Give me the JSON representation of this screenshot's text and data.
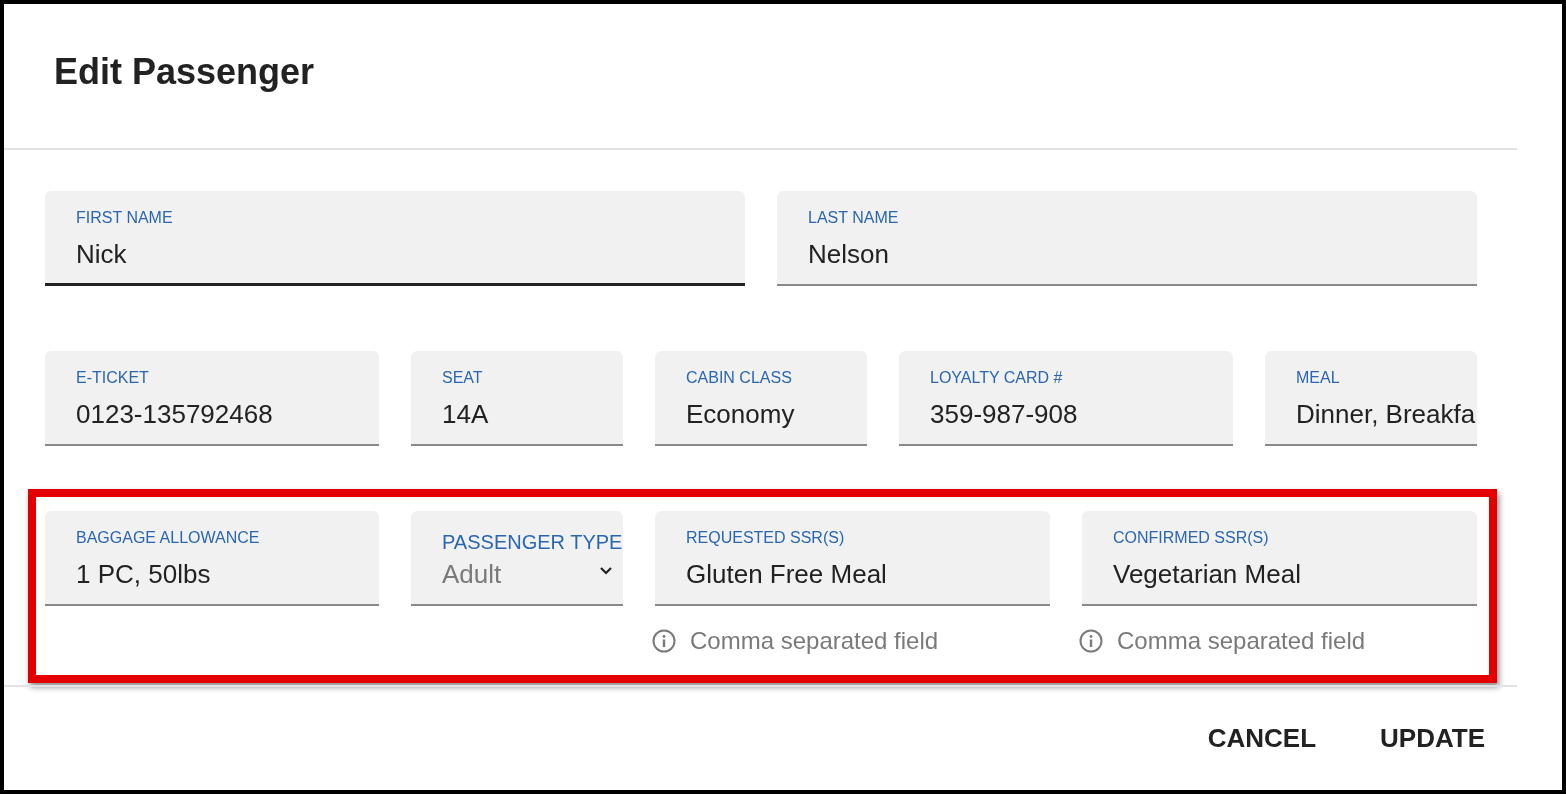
{
  "dialog": {
    "title": "Edit Passenger"
  },
  "rows": [
    {
      "highlighted": false,
      "fields": [
        {
          "kind": "text",
          "label": "FIRST NAME",
          "value": "Nick",
          "focused": true
        },
        {
          "kind": "text",
          "label": "LAST NAME",
          "value": "Nelson",
          "focused": false
        }
      ]
    },
    {
      "highlighted": false,
      "fields": [
        {
          "kind": "text",
          "label": "E-TICKET",
          "value": "0123-135792468",
          "focused": false
        },
        {
          "kind": "text",
          "label": "SEAT",
          "value": "14A",
          "focused": false
        },
        {
          "kind": "text",
          "label": "CABIN CLASS",
          "value": "Economy",
          "focused": false
        },
        {
          "kind": "text",
          "label": "LOYALTY CARD #",
          "value": "359-987-908",
          "focused": false
        },
        {
          "kind": "text",
          "label": "MEAL",
          "value": "Dinner, Breakfa",
          "focused": false
        }
      ]
    },
    {
      "highlighted": true,
      "fields": [
        {
          "kind": "text",
          "label": "BAGGAGE ALLOWANCE",
          "value": "1 PC, 50lbs",
          "focused": false
        },
        {
          "kind": "select",
          "label": "PASSENGER TYPE",
          "value": "Adult",
          "focused": false
        },
        {
          "kind": "text",
          "label": "REQUESTED SSR(S)",
          "value": "Gluten Free Meal",
          "focused": false,
          "helper": "Comma separated field"
        },
        {
          "kind": "text",
          "label": "CONFIRMED SSR(S)",
          "value": "Vegetarian Meal",
          "focused": false,
          "helper": "Comma separated field"
        }
      ]
    }
  ],
  "buttons": [
    "CANCEL",
    "UPDATE"
  ]
}
